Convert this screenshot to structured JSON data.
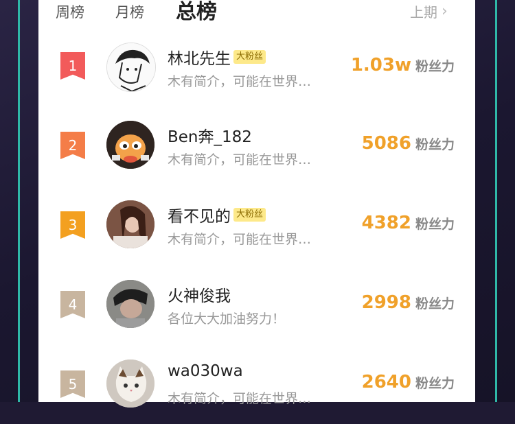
{
  "tabs": {
    "week": "周榜",
    "month": "月榜",
    "total": "总榜",
    "previous": "上期"
  },
  "unit_label": "粉丝力",
  "badge_label": "大粉丝",
  "colors": {
    "rank1": "#f25b5b",
    "rank2": "#f47d48",
    "rank3": "#f3a020",
    "rank_other": "#c8b59f",
    "score": "#f0a12a"
  },
  "entries": [
    {
      "rank": "1",
      "name": "林北先生",
      "badge": true,
      "bio": "木有简介，可能在世界…",
      "score": "1.03w",
      "avatar_icon": "anime-boy-avatar"
    },
    {
      "rank": "2",
      "name": "Ben奔_182",
      "badge": false,
      "bio": "木有简介，可能在世界…",
      "score": "5086",
      "avatar_icon": "cartoon-character-avatar"
    },
    {
      "rank": "3",
      "name": "看不见的",
      "badge": true,
      "bio": "木有简介，可能在世界…",
      "score": "4382",
      "avatar_icon": "woman-photo-avatar"
    },
    {
      "rank": "4",
      "name": "火神俊我",
      "badge": false,
      "bio": "各位大大加油努力！",
      "score": "2998",
      "avatar_icon": "man-photo-avatar"
    },
    {
      "rank": "5",
      "name": "wa030wa",
      "badge": false,
      "bio": "木有简介，可能在世界…",
      "score": "2640",
      "avatar_icon": "cat-photo-avatar"
    }
  ]
}
